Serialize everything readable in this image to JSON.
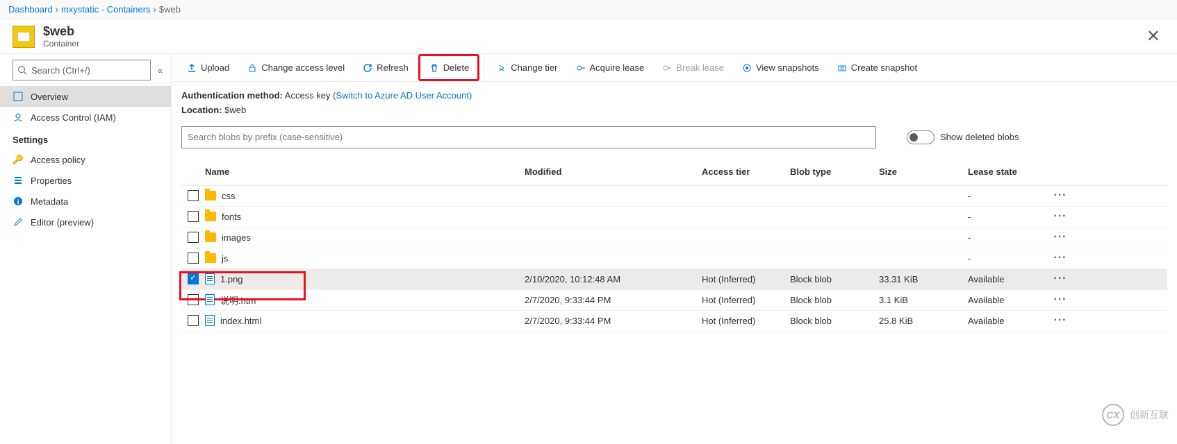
{
  "breadcrumb": {
    "items": [
      "Dashboard",
      "mxystatic - Containers"
    ],
    "current": "$web"
  },
  "header": {
    "title": "$web",
    "subtitle": "Container"
  },
  "sidebar": {
    "search_placeholder": "Search (Ctrl+/)",
    "items_top": [
      {
        "label": "Overview",
        "selected": true,
        "icon": "overview"
      },
      {
        "label": "Access Control (IAM)",
        "selected": false,
        "icon": "iam"
      }
    ],
    "settings_header": "Settings",
    "items_settings": [
      {
        "label": "Access policy",
        "icon": "key"
      },
      {
        "label": "Properties",
        "icon": "props"
      },
      {
        "label": "Metadata",
        "icon": "meta"
      },
      {
        "label": "Editor (preview)",
        "icon": "edit"
      }
    ]
  },
  "toolbar": {
    "upload": "Upload",
    "access_level": "Change access level",
    "refresh": "Refresh",
    "delete": "Delete",
    "change_tier": "Change tier",
    "acquire_lease": "Acquire lease",
    "break_lease": "Break lease",
    "view_snapshots": "View snapshots",
    "create_snapshot": "Create snapshot"
  },
  "info": {
    "auth_label": "Authentication method:",
    "auth_value": "Access key",
    "auth_link": "(Switch to Azure AD User Account)",
    "loc_label": "Location:",
    "loc_value": "$web"
  },
  "filter": {
    "placeholder": "Search blobs by prefix (case-sensitive)",
    "toggle_label": "Show deleted blobs"
  },
  "table": {
    "headers": {
      "name": "Name",
      "modified": "Modified",
      "tier": "Access tier",
      "type": "Blob type",
      "size": "Size",
      "lease": "Lease state"
    },
    "rows": [
      {
        "kind": "folder",
        "name": "css",
        "lease": "-"
      },
      {
        "kind": "folder",
        "name": "fonts",
        "lease": "-"
      },
      {
        "kind": "folder",
        "name": "images",
        "lease": "-"
      },
      {
        "kind": "folder",
        "name": "js",
        "lease": "-"
      },
      {
        "kind": "file",
        "name": "1.png",
        "modified": "2/10/2020, 10:12:48 AM",
        "tier": "Hot (Inferred)",
        "type": "Block blob",
        "size": "33.31 KiB",
        "lease": "Available",
        "selected": true,
        "highlight": true
      },
      {
        "kind": "file",
        "name": "说明.htm",
        "modified": "2/7/2020, 9:33:44 PM",
        "tier": "Hot (Inferred)",
        "type": "Block blob",
        "size": "3.1 KiB",
        "lease": "Available"
      },
      {
        "kind": "file",
        "name": "index.html",
        "modified": "2/7/2020, 9:33:44 PM",
        "tier": "Hot (Inferred)",
        "type": "Block blob",
        "size": "25.8 KiB",
        "lease": "Available"
      }
    ]
  },
  "watermark": {
    "brand": "创新互联"
  }
}
